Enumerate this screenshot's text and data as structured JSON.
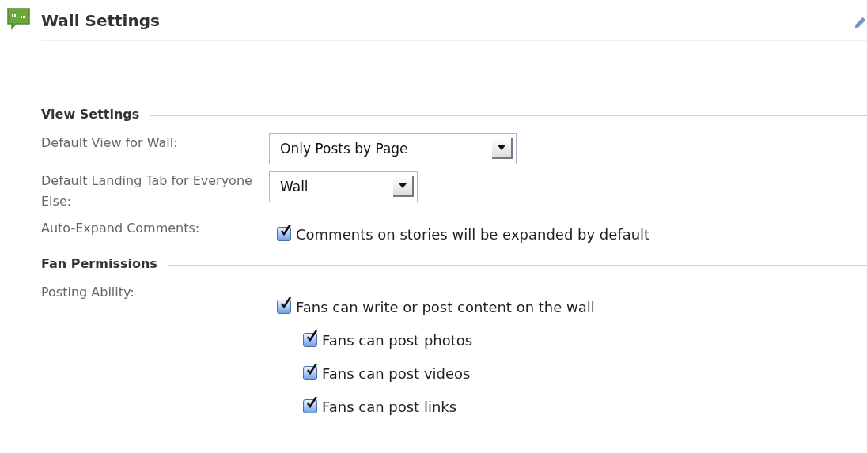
{
  "header": {
    "title": "Wall Settings"
  },
  "sections": [
    {
      "heading": "View Settings",
      "fields": [
        {
          "kind": "select",
          "label": "Default View for Wall:",
          "value": "Only Posts by Page"
        },
        {
          "kind": "select",
          "label": "Default Landing Tab for Everyone Else:",
          "value": "Wall"
        },
        {
          "kind": "checkbox",
          "label": "Auto-Expand Comments:",
          "options": [
            {
              "label": "Comments on stories will be expanded by default",
              "checked": true
            }
          ]
        }
      ]
    },
    {
      "heading": "Fan Permissions",
      "fields": [
        {
          "kind": "checkbox",
          "label": "Posting Ability:",
          "options": [
            {
              "label": "Fans can write or post content on the wall",
              "checked": true,
              "children": [
                {
                  "label": "Fans can post photos",
                  "checked": true
                },
                {
                  "label": "Fans can post videos",
                  "checked": true
                },
                {
                  "label": "Fans can post links",
                  "checked": true
                }
              ]
            }
          ]
        }
      ]
    }
  ]
}
